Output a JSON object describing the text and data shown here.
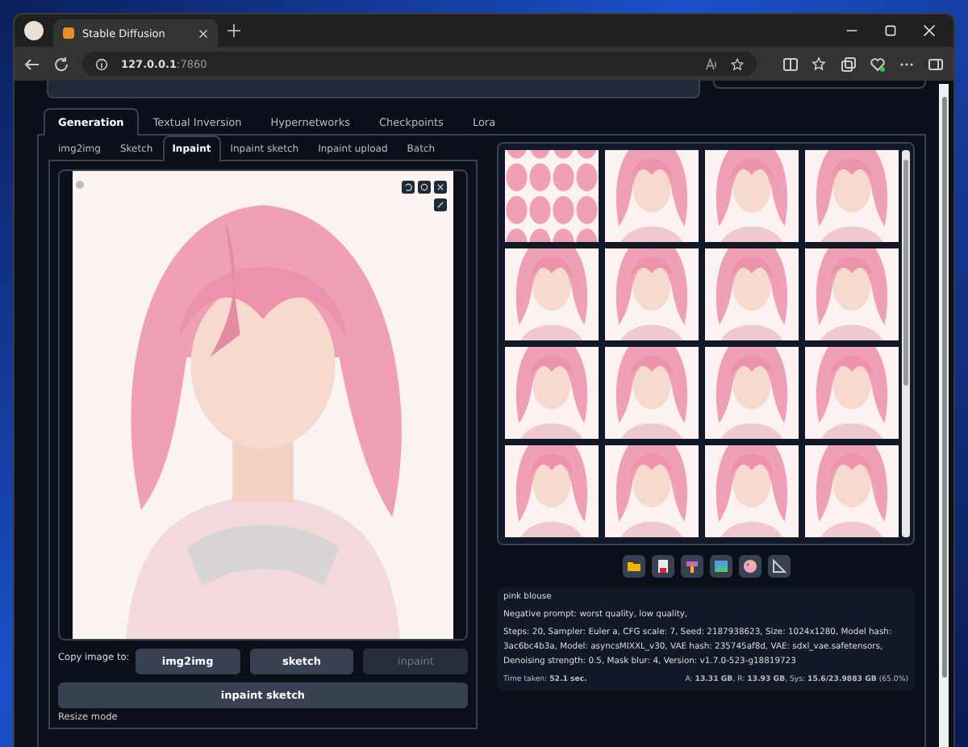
{
  "browser": {
    "tab_title": "Stable Diffusion",
    "url_host": "127.0.0.1",
    "url_port": ":7860"
  },
  "tabs": [
    {
      "label": "Generation",
      "selected": true
    },
    {
      "label": "Textual Inversion",
      "selected": false
    },
    {
      "label": "Hypernetworks",
      "selected": false
    },
    {
      "label": "Checkpoints",
      "selected": false
    },
    {
      "label": "Lora",
      "selected": false
    }
  ],
  "subtabs": [
    {
      "label": "img2img",
      "selected": false
    },
    {
      "label": "Sketch",
      "selected": false
    },
    {
      "label": "Inpaint",
      "selected": true
    },
    {
      "label": "Inpaint sketch",
      "selected": false
    },
    {
      "label": "Inpaint upload",
      "selected": false
    },
    {
      "label": "Batch",
      "selected": false
    }
  ],
  "copy_image": {
    "label": "Copy image to:",
    "buttons": [
      {
        "label": "img2img",
        "disabled": false
      },
      {
        "label": "sketch",
        "disabled": false
      },
      {
        "label": "inpaint",
        "disabled": true
      }
    ],
    "wide_button": "inpaint sketch"
  },
  "next_section": "Resize mode",
  "info": {
    "prompt": "pink blouse",
    "negative": "Negative prompt: worst quality, low quality,",
    "params": "Steps: 20, Sampler: Euler a, CFG scale: 7, Seed: 2187938623, Size: 1024x1280, Model hash: 3ac6bc4b3a, Model: asyncsMIXXL_v30, VAE hash: 235745af8d, VAE: sdxl_vae.safetensors, Denoising strength: 0.5, Mask blur: 4, Version: v1.7.0-523-g18819723",
    "time": "Time taken: **52.1 sec.**",
    "memory": "A: **13.31 GB**, R: **13.93 GB**, Sys: **15.6/23.9883 GB** (65.0%)"
  }
}
